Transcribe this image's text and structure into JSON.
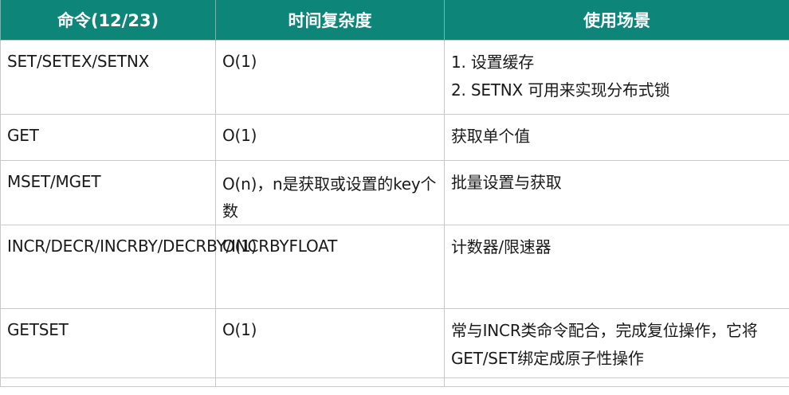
{
  "table": {
    "headers": [
      "命令(12/23)",
      "时间复杂度",
      "使用场景"
    ],
    "rows": [
      {
        "command": "SET/SETEX/SETNX",
        "complexity": "O(1)",
        "usage": [
          "1. 设置缓存",
          "2. SETNX 可用来实现分布式锁"
        ]
      },
      {
        "command": "GET",
        "complexity": "O(1)",
        "usage": [
          "获取单个值"
        ]
      },
      {
        "command": "MSET/MGET",
        "complexity": "O(n)，n是获取或设置的key个数",
        "usage": [
          "批量设置与获取"
        ]
      },
      {
        "command": "INCR/DECR/INCRBY/DECRBY/INCRBYFLOAT",
        "complexity": "O(1)",
        "usage": [
          "计数器/限速器"
        ]
      },
      {
        "command": "GETSET",
        "complexity": "O(1)",
        "usage": [
          "常与INCR类命令配合，完成复位操作，它将GET/SET绑定成原子性操作"
        ]
      }
    ]
  },
  "colors": {
    "header_bg": "#0e8579",
    "header_text": "#ffffff",
    "grid": "#c9c9c9"
  }
}
